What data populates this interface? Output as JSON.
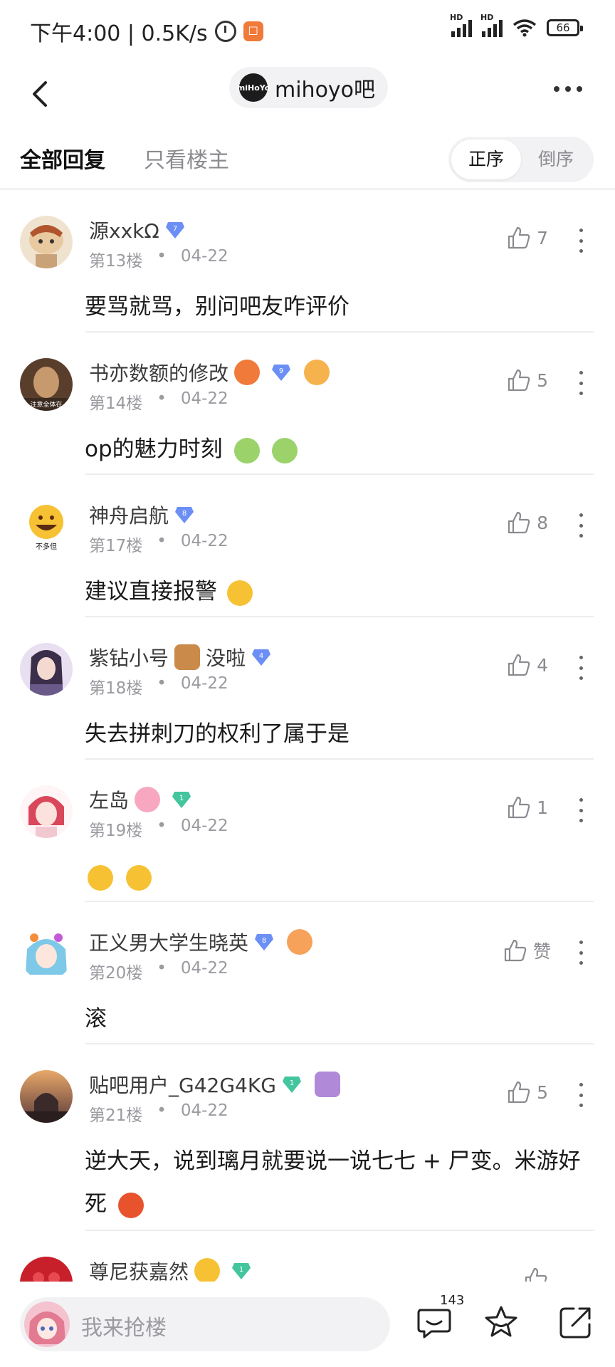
{
  "status_bar": {
    "time_speed": "下午4:00 | 0.5K/s",
    "hd1": "HD",
    "hd2": "HD",
    "battery": "66"
  },
  "nav": {
    "forum_name": "mihoyo吧",
    "forum_logo_text": "miHoYo"
  },
  "tabs": {
    "all_replies": "全部回复",
    "only_op": "只看楼主",
    "order_asc": "正序",
    "order_desc": "倒序"
  },
  "posts": [
    {
      "username": "源xxkΩ",
      "level": "7",
      "floor": "第13楼",
      "date": "04-22",
      "likes": "7",
      "content": "要骂就骂，别问吧友咋评价"
    },
    {
      "username": "书亦数额的修改",
      "level": "9",
      "floor": "第14楼",
      "date": "04-22",
      "likes": "5",
      "content": "op的魅力时刻"
    },
    {
      "username": "神舟启航",
      "level": "8",
      "floor": "第17楼",
      "date": "04-22",
      "likes": "8",
      "content": "建议直接报警"
    },
    {
      "username": "紫钻小号",
      "username_suffix": "没啦",
      "level": "4",
      "floor": "第18楼",
      "date": "04-22",
      "likes": "4",
      "content": "失去拼刺刀的权利了属于是"
    },
    {
      "username": "左岛",
      "level": "1",
      "floor": "第19楼",
      "date": "04-22",
      "likes": "1",
      "content": ""
    },
    {
      "username": "正义男大学生晓英",
      "level": "8",
      "floor": "第20楼",
      "date": "04-22",
      "likes": "赞",
      "content": "滚"
    },
    {
      "username": "贴吧用户_G42G4KG",
      "level": "1",
      "floor": "第21楼",
      "date": "04-22",
      "likes": "5",
      "content": "逆大天，说到璃月就要说一说七七 + 尸变。米游好死"
    },
    {
      "username": "尊尼获嘉然",
      "level": "1",
      "floor": "",
      "date": "",
      "likes": "",
      "content": ""
    }
  ],
  "bottom_bar": {
    "reply_placeholder": "我来抢楼",
    "comment_count": "143"
  },
  "colors": {
    "accent_blue": "#6b8ff5",
    "badge_green": "#43c59e",
    "text_primary": "#1a1a1a",
    "text_secondary": "#9a9aa0"
  }
}
